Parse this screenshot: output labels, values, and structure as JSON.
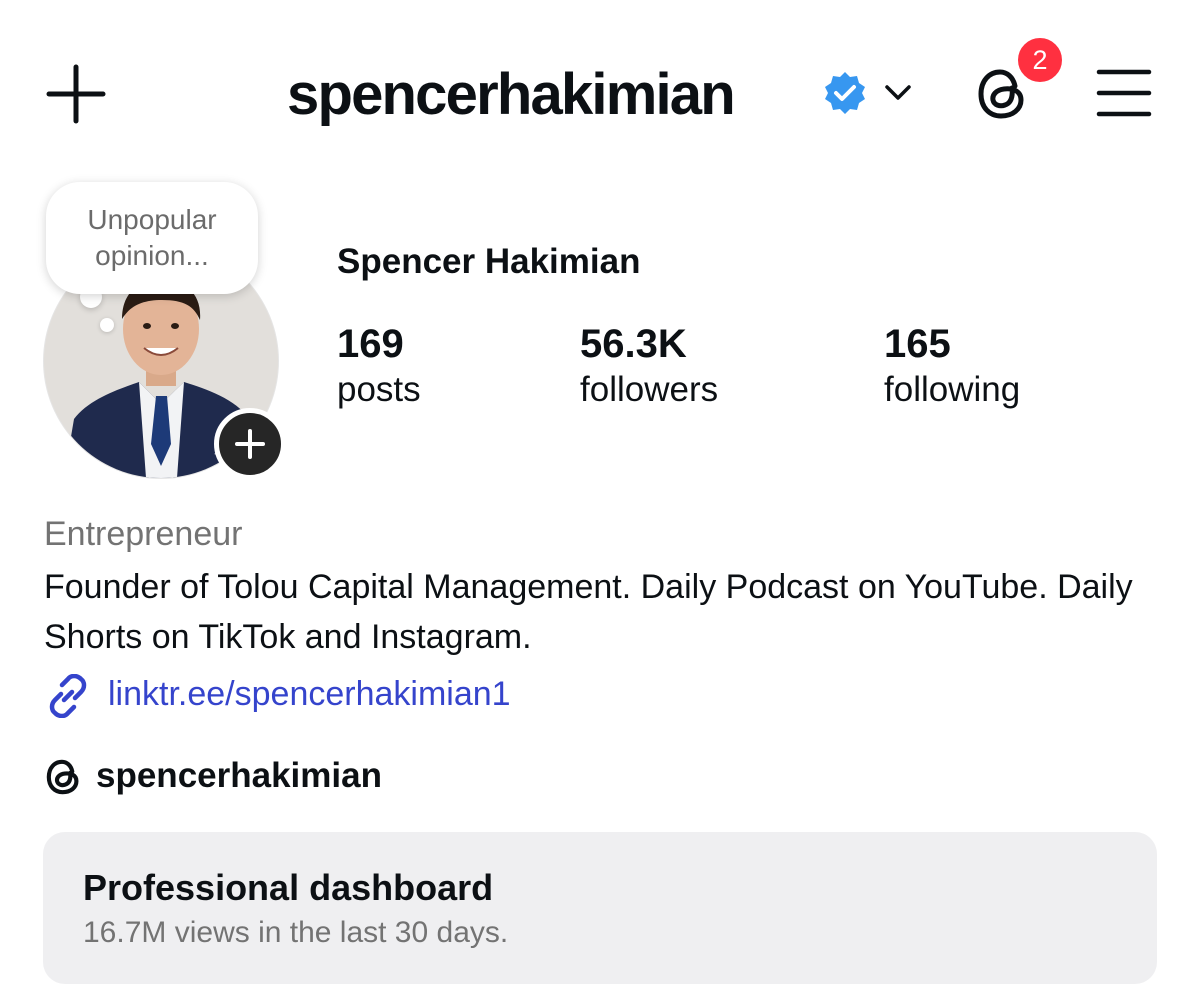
{
  "header": {
    "username": "spencerhakimian",
    "verified_icon": "verified-badge-icon",
    "threads_badge_count": "2",
    "icons": [
      "plus-icon",
      "chevron-down-icon",
      "threads-icon",
      "menu-icon"
    ],
    "badge_color": "#ff3040",
    "verified_color": "#3797f0"
  },
  "profile": {
    "note": "Unpopular opinion...",
    "full_name": "Spencer Hakimian",
    "stats": [
      {
        "value": "169",
        "label": "posts"
      },
      {
        "value": "56.3K",
        "label": "followers"
      },
      {
        "value": "165",
        "label": "following"
      }
    ]
  },
  "bio": {
    "category": "Entrepreneur",
    "text": "Founder of Tolou Capital Management. Daily Podcast on YouTube. Daily Shorts on TikTok and Instagram.",
    "link": "linktr.ee/spencerhakimian1",
    "link_color": "#3544cc",
    "threads_handle": "spencerhakimian"
  },
  "dashboard": {
    "title": "Professional dashboard",
    "subtitle": "16.7M views in the last 30 days."
  }
}
